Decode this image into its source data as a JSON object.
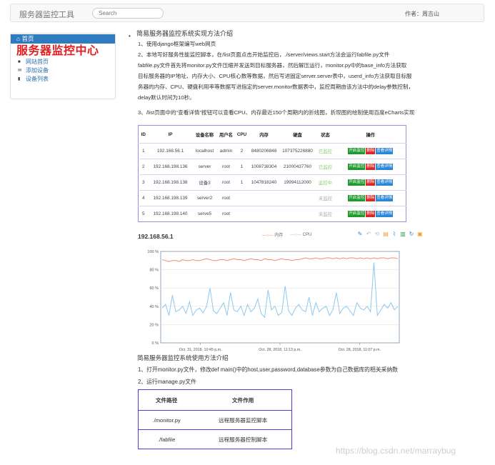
{
  "navbar": {
    "brand": "服务器监控工具",
    "search_placeholder": "Search",
    "author": "作者：周吉山"
  },
  "sidebar": {
    "home_label": "首页",
    "title": "服务器监控中心",
    "links": [
      {
        "icon": "globe-icon",
        "label": "网站首页"
      },
      {
        "icon": "envelope-icon",
        "label": "添加设备"
      },
      {
        "icon": "file-icon",
        "label": "设备列表"
      }
    ]
  },
  "intro": {
    "heading": "简易服务器监控系统实现方法介绍",
    "lines": [
      "1、使用django框架编写web网页",
      "2、本地写好服务性能监控脚本，在/list页面点击开始监控后，./server/views.start方法会运行fabfile.py文件",
      "fabfile.py文件首先将monitor.py文件压缩并发送到目标服务器，然后解压运行，monitor.py中的base_info方法获取",
      "目标服务器的IP地址、内存大小、CPU核心数等数据，然后写进固定server.server表中，userd_info方法获取目标服",
      "务器的内存、CPU、硬盘利用率等数据写进指定的server.monitor数据表中，监控周期由该方法中的delay参数控制，",
      "delay默认时间为10秒。",
      "3、/list页面中的“查看详情”按钮可以查看CPU、内存最近150个周期内的折线图，折现图的绘制使用百度eCharts实现"
    ]
  },
  "hosts_table": {
    "headers": [
      "ID",
      "IP",
      "设备名称",
      "用户名",
      "CPU",
      "内存",
      "硬盘",
      "状态",
      "操作"
    ],
    "rows": [
      {
        "id": "1",
        "ip": "192.168.56.1",
        "name": "localhost",
        "user": "admin",
        "cpu": "2",
        "mem": "8480206848",
        "disk": "107375226880",
        "status": "已监控",
        "status_color": "#7fd36f"
      },
      {
        "id": "2",
        "ip": "192.168.198.136",
        "name": "server",
        "user": "root",
        "cpu": "1",
        "mem": "1008738304",
        "disk": "21000437760",
        "status": "已监控",
        "status_color": "#7fd36f"
      },
      {
        "id": "3",
        "ip": "192.168.198.138",
        "name": "设备3",
        "user": "root",
        "cpu": "1",
        "mem": "1047818240",
        "disk": "19994112000",
        "status": "监控中",
        "status_color": "#7fd36f"
      },
      {
        "id": "4",
        "ip": "192.168.198.139",
        "name": "server2",
        "user": "root",
        "cpu": "",
        "mem": "",
        "disk": "",
        "status": "未监控",
        "status_color": "#aaaaaa"
      },
      {
        "id": "5",
        "ip": "192.168.198.140",
        "name": "serve5",
        "user": "root",
        "cpu": "",
        "mem": "",
        "disk": "",
        "status": "未监控",
        "status_color": "#aaaaaa"
      }
    ],
    "btn_start": "开启监控",
    "btn_delete": "删除",
    "btn_detail": "查看详情"
  },
  "chart_panel": {
    "host_title": "192.168.56.1",
    "tools": [
      "edit-icon",
      "undo-icon",
      "refresh-icon",
      "data-view-icon",
      "line-icon",
      "bar-icon",
      "restore-icon",
      "save-icon"
    ]
  },
  "chart_data": {
    "type": "line",
    "x": [
      "Oct. 31, 2018, 10:45 p.m.",
      "Oct. 28, 2018, 11:13 p.m.",
      "Oct. 28, 2018, 11:07 p.m."
    ],
    "ylim": [
      0,
      100
    ],
    "yticks": [
      "0 %",
      "20 %",
      "40 %",
      "60 %",
      "80 %",
      "100 %"
    ],
    "series": [
      {
        "name": "内存",
        "color": "#f28c66",
        "values": [
          91,
          90,
          89,
          90,
          90,
          89,
          91,
          90,
          90,
          91,
          90,
          90,
          91,
          92,
          91,
          90,
          90,
          91,
          91,
          90,
          91,
          92,
          91,
          91,
          90,
          91,
          92,
          91,
          91,
          90,
          92,
          91,
          91,
          90,
          91,
          92,
          91,
          91,
          90,
          91,
          91,
          92,
          93,
          92,
          92,
          93,
          92,
          92,
          93,
          93,
          92,
          93,
          92,
          93,
          92,
          93,
          93,
          92,
          93,
          92,
          93,
          92,
          93,
          92,
          93,
          93,
          92,
          93,
          93,
          92
        ]
      },
      {
        "name": "CPU",
        "color": "#8ec9ee",
        "values": [
          38,
          42,
          30,
          52,
          34,
          36,
          40,
          32,
          45,
          30,
          36,
          38,
          33,
          40,
          60,
          35,
          32,
          38,
          44,
          30,
          55,
          36,
          34,
          40,
          30,
          42,
          34,
          38,
          48,
          32,
          28,
          58,
          36,
          40,
          30,
          33,
          62,
          35,
          30,
          38,
          42,
          36,
          34,
          50,
          30,
          44,
          34,
          38,
          40,
          30,
          36,
          55,
          32,
          38,
          40,
          35,
          30,
          44,
          38,
          36,
          40,
          34,
          88,
          30,
          36,
          42,
          38,
          44,
          36,
          40
        ]
      }
    ]
  },
  "usage": {
    "heading": "简易服务器监控系统使用方法介绍",
    "lines": [
      "1、打开monitor.py文件，修改def main()中的host,user,password,database参数为自己数据库的相关采纳数",
      "2、运行manage.py文件"
    ]
  },
  "files_table": {
    "headers": [
      "文件路径",
      "文件作用"
    ],
    "rows": [
      {
        "path": "./monitor.py",
        "desc": "远程服务器监控脚本"
      },
      {
        "path": "./fabfile",
        "desc": "远程服务器控制脚本"
      }
    ]
  },
  "watermark": "https://blog.csdn.net/marraybug"
}
